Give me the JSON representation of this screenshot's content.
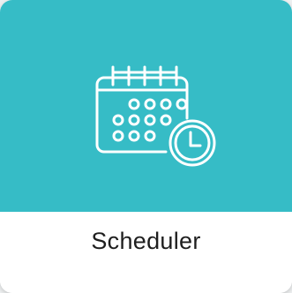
{
  "tile": {
    "label": "Scheduler",
    "icon": "calendar-clock-icon",
    "accent_color": "#36bcc6",
    "icon_color": "#ffffff",
    "label_color": "#1e1e1e"
  }
}
